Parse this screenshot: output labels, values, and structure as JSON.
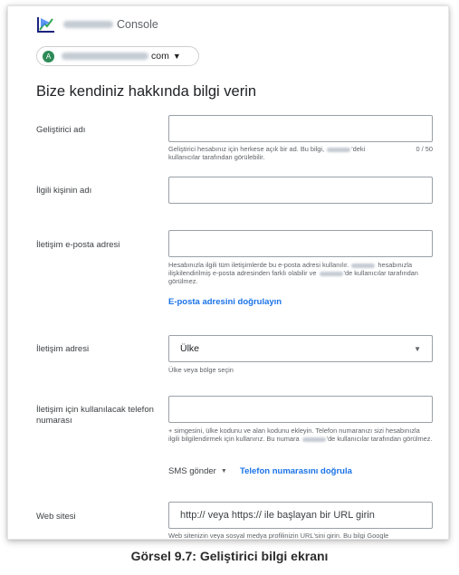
{
  "header": {
    "console_label": "Console",
    "account_suffix": "com",
    "account_initial": "A"
  },
  "page": {
    "title": "Bize kendiniz hakkında bilgi verin"
  },
  "fields": {
    "developer_name": {
      "label": "Geliştirici adı",
      "help_part1": "Geliştirici hesabınız için herkese açık bir ad. Bu bilgi,",
      "help_part2": "'deki kullanıcılar tarafından görülebilir.",
      "counter": "0 / 50"
    },
    "contact_name": {
      "label": "İlgili kişinin adı"
    },
    "contact_email": {
      "label": "İletişim e-posta adresi",
      "help_part1": "Hesabınızla ilgili tüm iletişimlerde bu e-posta adresi kullanılır.",
      "help_part2": "hesabınızla ilişkilendirilmiş e-posta adresinden farklı olabilir ve",
      "help_part3": "'de kullanıcılar tarafından görülmez.",
      "verify_link": "E-posta adresini doğrulayın"
    },
    "contact_address": {
      "label": "İletişim adresi",
      "select_value": "Ülke",
      "help": "Ülke veya bölge seçin"
    },
    "contact_phone": {
      "label": "İletişim için kullanılacak telefon numarası",
      "help_part1": "+ simgesini, ülke kodunu ve alan kodunu ekleyin. Telefon numaranızı sizi hesabınızla ilgili bilgilendirmek için kullanırız. Bu numara",
      "help_part2": "'de kullanıcılar tarafından görülmez.",
      "sms_label": "SMS gönder",
      "verify_link": "Telefon numarasını doğrula"
    },
    "website": {
      "label": "Web sitesi",
      "placeholder": "http:// veya https:// ile başlayan bir URL girin",
      "help": "Web sitenizin veya sosyal medya profilinizin URL'sini girin. Bu bilgi Google"
    }
  },
  "caption": "Görsel 9.7: Geliştirici bilgi ekranı"
}
